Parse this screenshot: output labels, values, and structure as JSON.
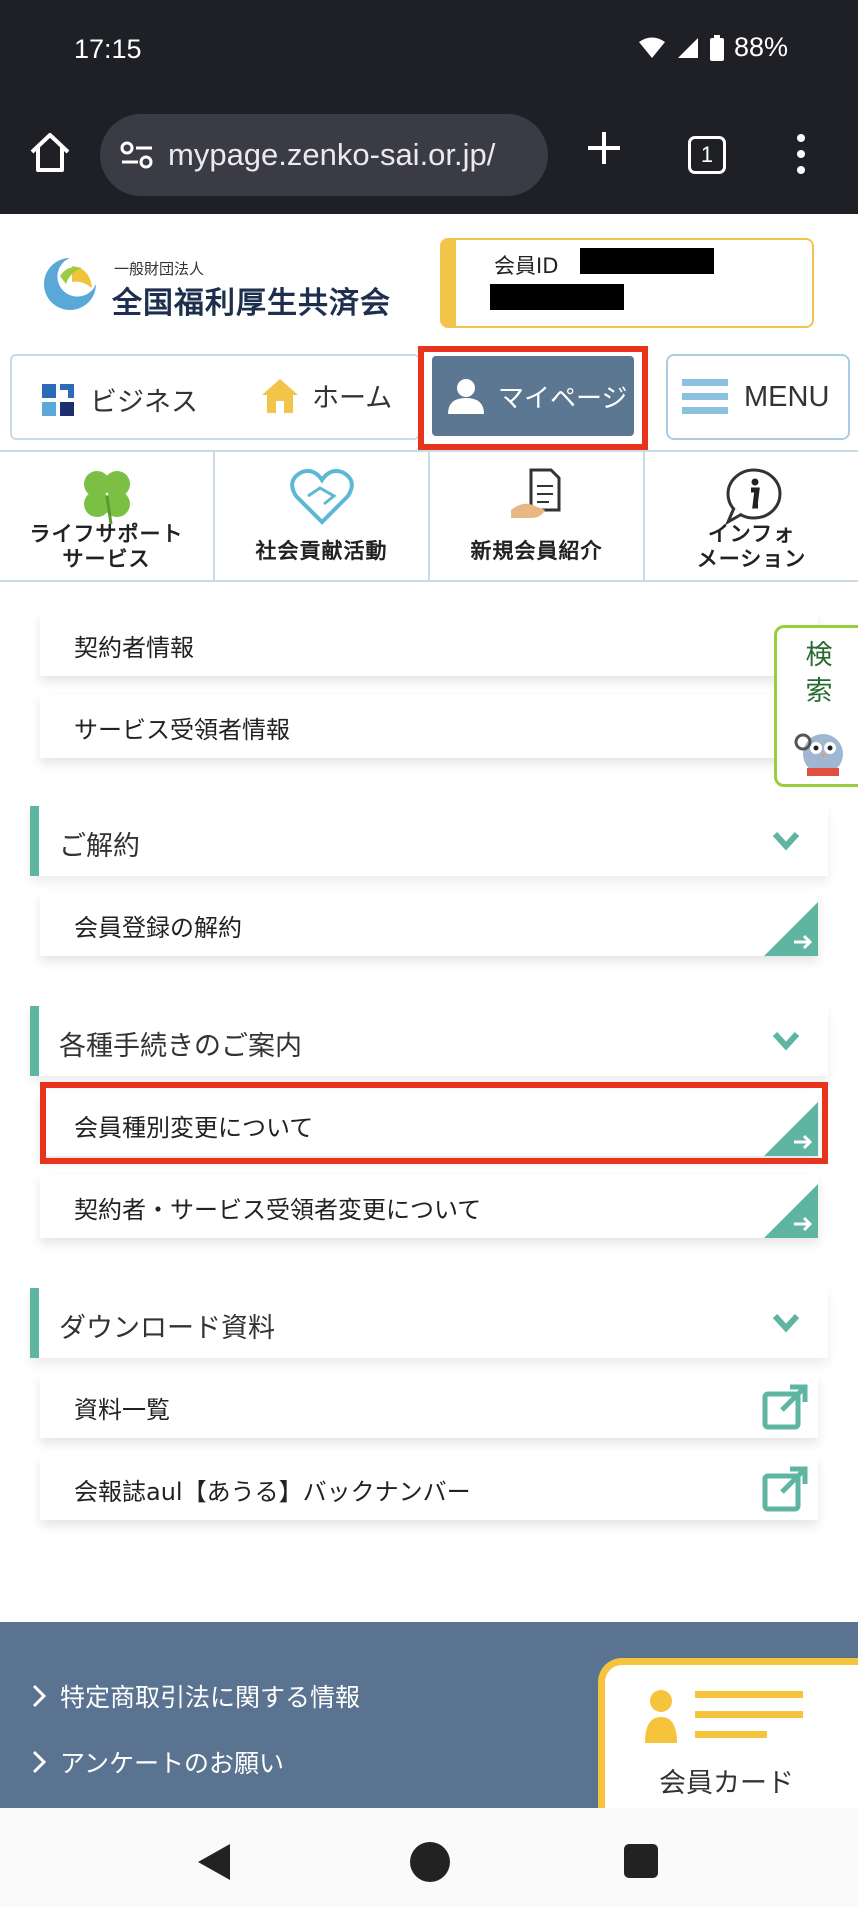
{
  "status": {
    "time": "17:15",
    "battery": "88%"
  },
  "browser": {
    "url": "mypage.zenko-sai.or.jp/",
    "tab_count": "1"
  },
  "header": {
    "org_small": "一般財団法人",
    "org_name": "全国福利厚生共済会",
    "member_label": "会員ID"
  },
  "nav": {
    "business": "ビジネス",
    "home": "ホーム",
    "mypage": "マイページ",
    "menu": "MENU"
  },
  "subnav": [
    {
      "line1": "ライフサポート",
      "line2": "サービス",
      "icon": "clover-icon"
    },
    {
      "line1": "社会貢献活動",
      "line2": "",
      "icon": "heart-handshake-icon"
    },
    {
      "line1": "新規会員紹介",
      "line2": "",
      "icon": "document-hand-icon"
    },
    {
      "line1": "インフォ",
      "line2": "メーション",
      "icon": "info-bubble-icon"
    }
  ],
  "content": {
    "rows_top": [
      "契約者情報",
      "サービス受領者情報"
    ],
    "section_cancel": {
      "title": "ご解約",
      "items": [
        "会員登録の解約"
      ]
    },
    "section_procedures": {
      "title": "各種手続きのご案内",
      "items": [
        "会員種別変更について",
        "契約者・サービス受領者変更について"
      ]
    },
    "section_downloads": {
      "title": "ダウンロード資料",
      "items": [
        "資料一覧",
        "会報誌aul【あうる】バックナンバー"
      ]
    }
  },
  "search_tab": {
    "label": "検索"
  },
  "footer": {
    "links": [
      "特定商取引法に関する情報",
      "アンケートのお願い"
    ],
    "card_label": "会員カード"
  },
  "colors": {
    "accent_teal": "#5eb5a2",
    "highlight_red": "#e8341c",
    "mypage_blue": "#5b7792",
    "footer_blue": "#5a7391",
    "card_yellow": "#f5c33c"
  }
}
